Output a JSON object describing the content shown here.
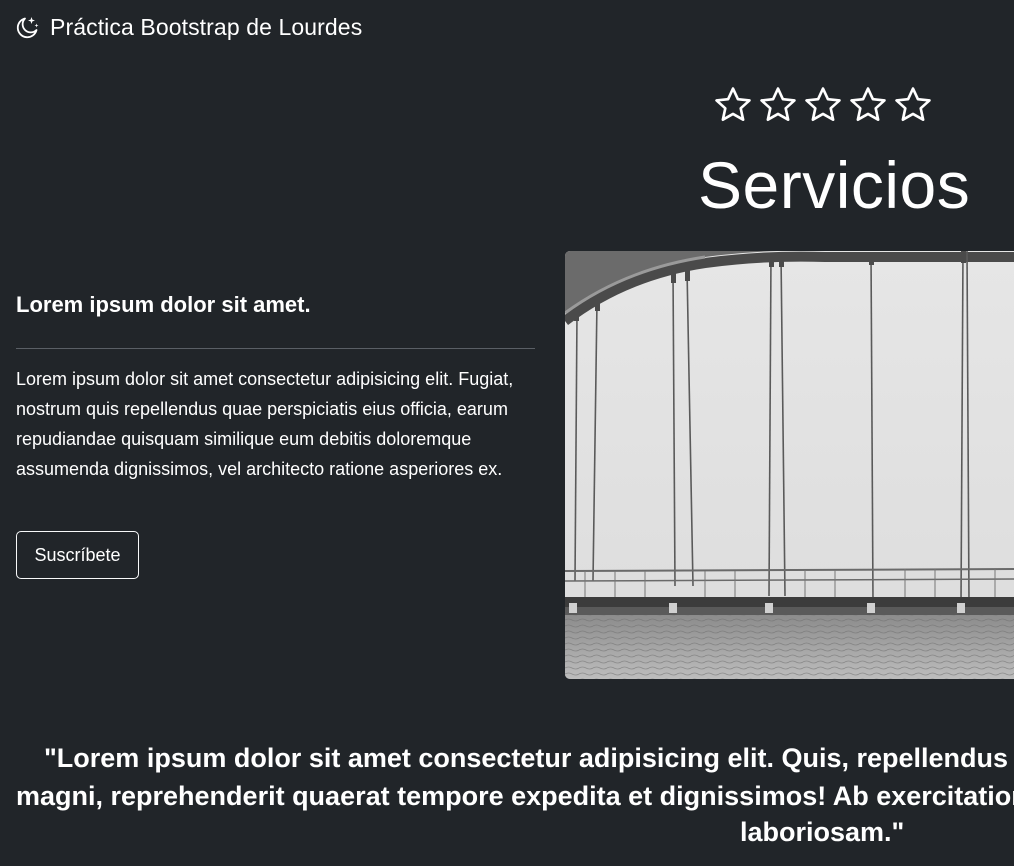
{
  "navbar": {
    "brand_icon": "moon-stars-icon",
    "brand_text": "Práctica Bootstrap de Lourdes"
  },
  "rating": {
    "icon": "star-outline-icon",
    "stars_total": 5,
    "stars_filled": 0
  },
  "services": {
    "title": "Servicios"
  },
  "card": {
    "heading": "Lorem ipsum dolor sit amet.",
    "text": "Lorem ipsum dolor sit amet consectetur adipisicing elit. Fugiat, nostrum quis repellendus quae perspiciatis eius officia, earum repudiandae quisquam similique eum debitis doloremque assumenda dignissimos, vel architecto ratione asperiores ex.",
    "button_label": "Suscríbete"
  },
  "image": {
    "subject": "bridge-photo"
  },
  "quote": {
    "line1": "\"Lorem ipsum dolor sit amet consectetur adipisicing elit. Quis, repellendus",
    "line2": "magni, reprehenderit quaerat tempore expedita et dignissimos! Ab exercitationem",
    "line3": "laboriosam.\""
  },
  "colors": {
    "background": "#212529",
    "text": "#ffffff",
    "divider": "#5a5f65"
  }
}
